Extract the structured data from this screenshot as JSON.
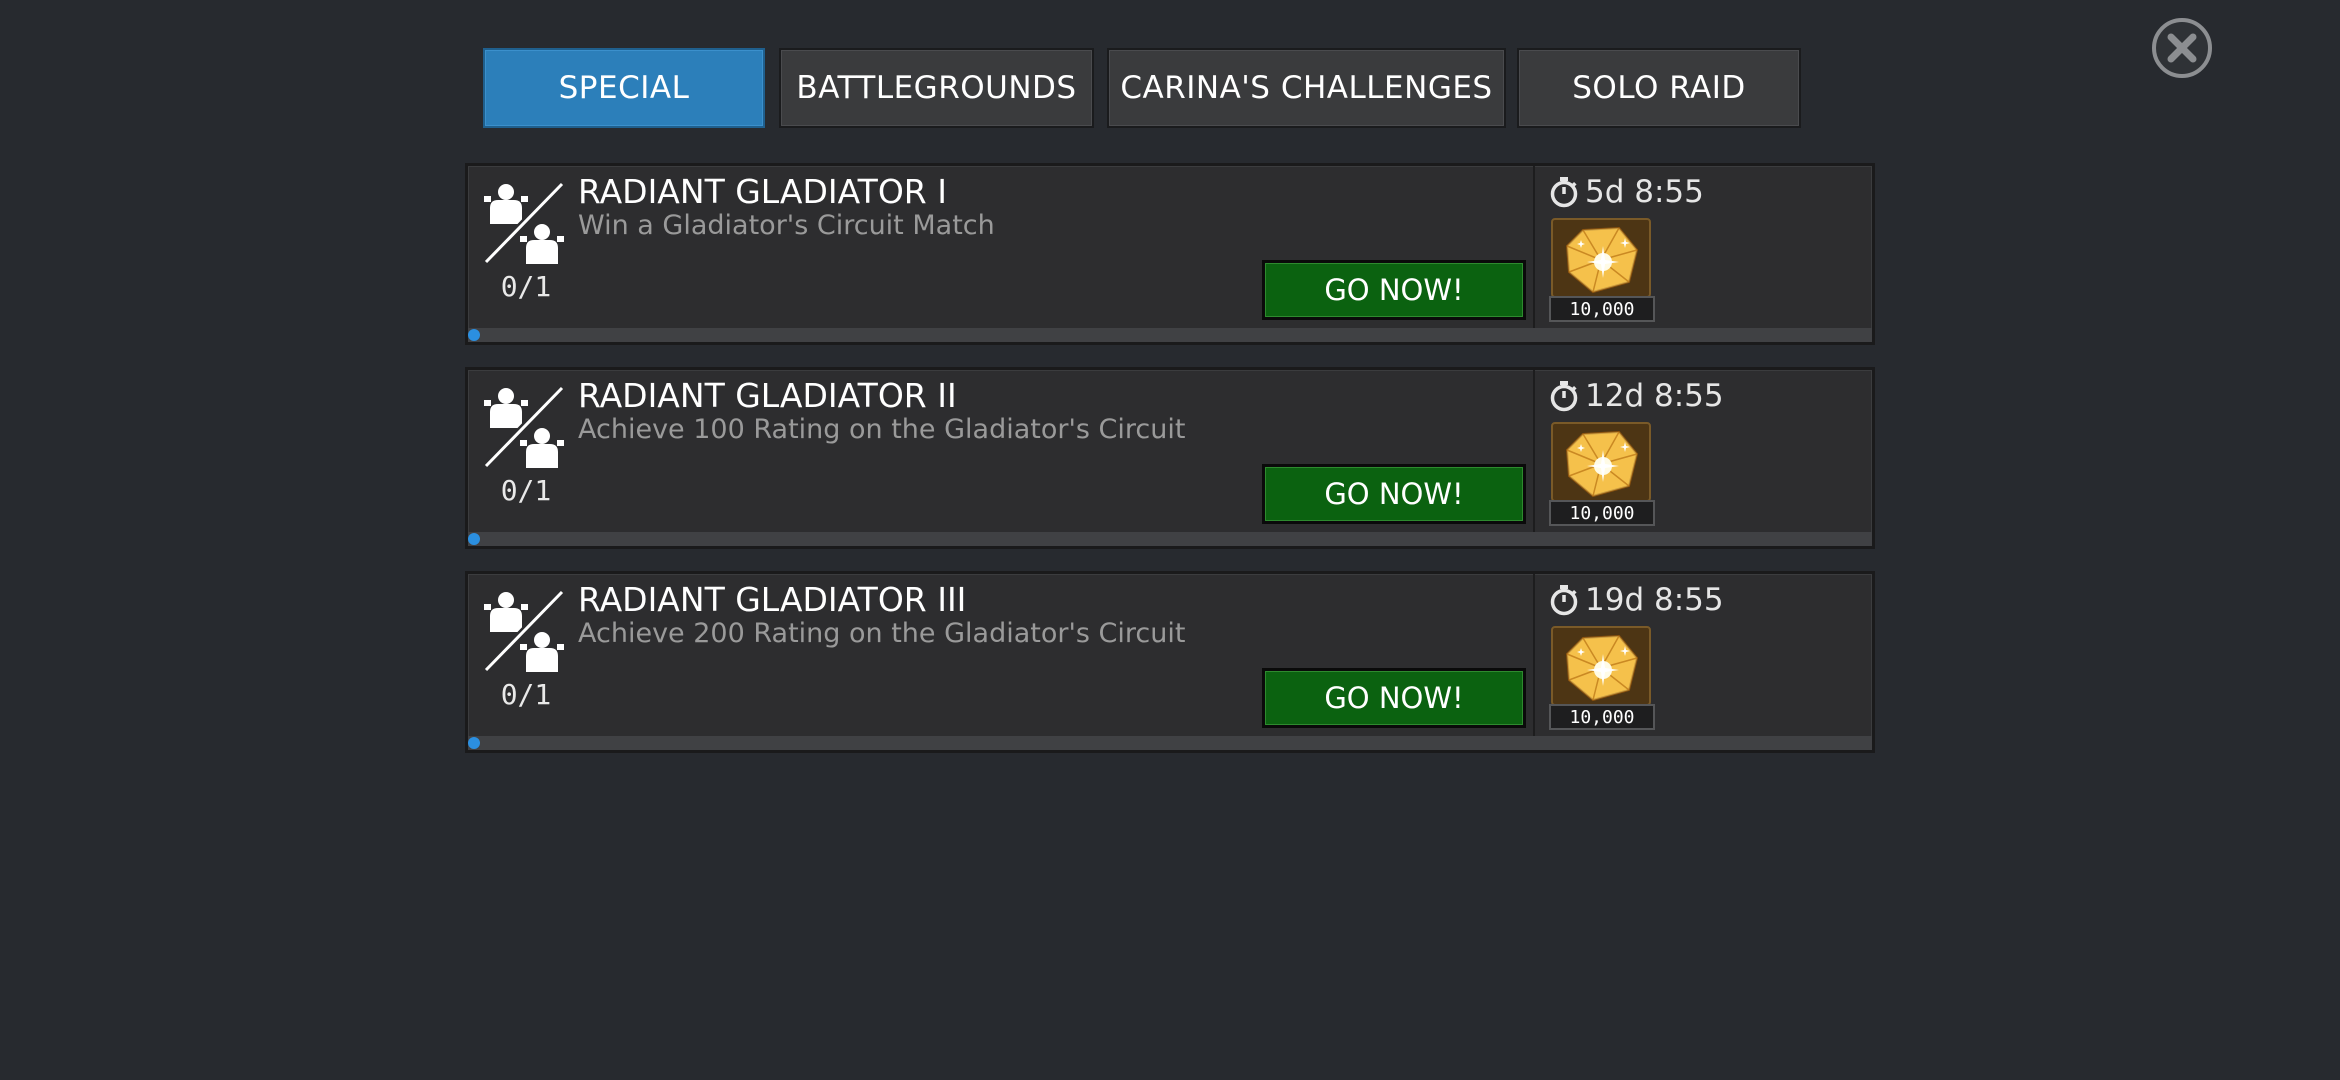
{
  "tabs": [
    {
      "label": "SPECIAL",
      "active": true
    },
    {
      "label": "BATTLEGROUNDS",
      "active": false
    },
    {
      "label": "CARINA'S CHALLENGES",
      "active": false
    },
    {
      "label": "SOLO RAID",
      "active": false
    }
  ],
  "close_icon": "close-icon",
  "missions": [
    {
      "title": "RADIANT GLADIATOR I",
      "description": "Win a Gladiator's Circuit Match",
      "progress_text": "0/1",
      "progress_value": 0,
      "button_label": "GO NOW!",
      "timer": "5d 8:55",
      "reward_amount": "10,000",
      "icon": "versus-icon",
      "reward_icon": "gold-crystal-icon"
    },
    {
      "title": "RADIANT GLADIATOR II",
      "description": "Achieve 100 Rating on the Gladiator's Circuit",
      "progress_text": "0/1",
      "progress_value": 0,
      "button_label": "GO NOW!",
      "timer": "12d 8:55",
      "reward_amount": "10,000",
      "icon": "versus-icon",
      "reward_icon": "gold-crystal-icon"
    },
    {
      "title": "RADIANT GLADIATOR III",
      "description": "Achieve 200 Rating on the Gladiator's Circuit",
      "progress_text": "0/1",
      "progress_value": 0,
      "button_label": "GO NOW!",
      "timer": "19d 8:55",
      "reward_amount": "10,000",
      "icon": "versus-icon",
      "reward_icon": "gold-crystal-icon"
    }
  ],
  "colors": {
    "background": "#272a2f",
    "tab_active": "#2c7fba",
    "tab_inactive": "#3a3b3d",
    "go_button": "#0b6210",
    "progress": "#2b8fe0"
  }
}
